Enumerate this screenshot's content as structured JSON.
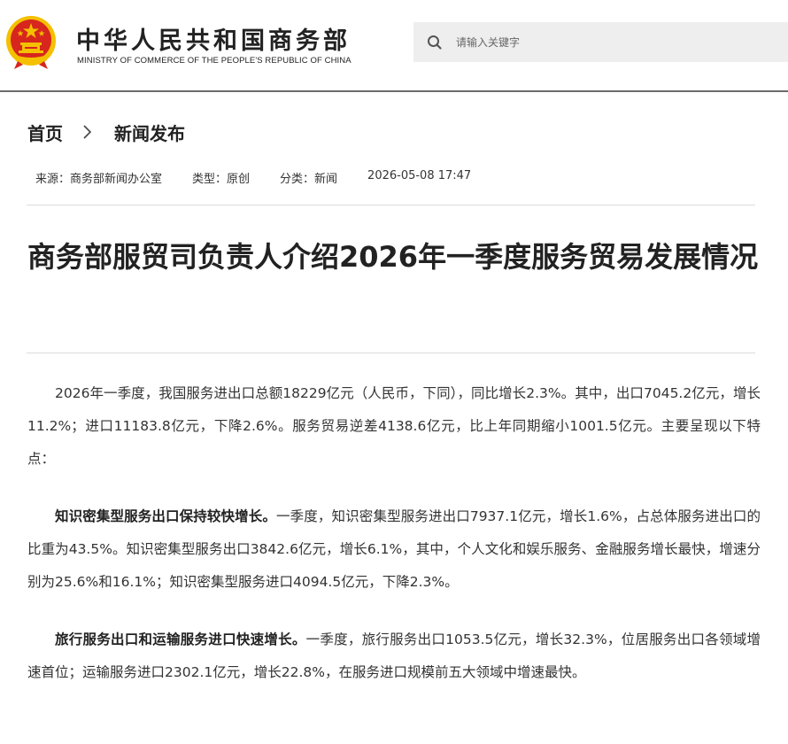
{
  "header": {
    "ministry_name_cn": "中华人民共和国商务部",
    "ministry_name_en": "MINISTRY OF COMMERCE OF THE PEOPLE'S REPUBLIC OF CHINA",
    "search_placeholder": "请输入关键字",
    "search_value": ""
  },
  "breadcrumb": {
    "home": "首页",
    "current": "新闻发布"
  },
  "meta": {
    "source": "来源：商务部新闻办公室",
    "type": "类型：原创",
    "category": "分类：新闻",
    "datetime": "2026-05-08 17:47"
  },
  "article": {
    "title": "商务部服贸司负责人介绍2026年一季度服务贸易发展情况",
    "paragraphs": [
      {
        "lead": "",
        "text": "2026年一季度，我国服务进出口总额18229亿元（人民币，下同），同比增长2.3%。其中，出口7045.2亿元，增长11.2%；进口11183.8亿元，下降2.6%。服务贸易逆差4138.6亿元，比上年同期缩小1001.5亿元。主要呈现以下特点："
      },
      {
        "lead": "知识密集型服务出口保持较快增长。",
        "text": "一季度，知识密集型服务进出口7937.1亿元，增长1.6%，占总体服务进出口的比重为43.5%。知识密集型服务出口3842.6亿元，增长6.1%，其中，个人文化和娱乐服务、金融服务增长最快，增速分别为25.6%和16.1%；知识密集型服务进口4094.5亿元，下降2.3%。"
      },
      {
        "lead": "旅行服务出口和运输服务进口快速增长。",
        "text": "一季度，旅行服务出口1053.5亿元，增长32.3%，位居服务出口各领域增速首位；运输服务进口2302.1亿元，增长22.8%，在服务进口规模前五大领域中增速最快。"
      }
    ]
  },
  "colors": {
    "emblem_red": "#d7261e",
    "emblem_gold": "#f4c000",
    "header_rule": "#6b6b6b",
    "search_bg": "#eeeeee"
  },
  "icons": {
    "emblem": "national-emblem-icon",
    "search": "search-icon",
    "breadcrumb_separator": "chevron-right-icon"
  }
}
